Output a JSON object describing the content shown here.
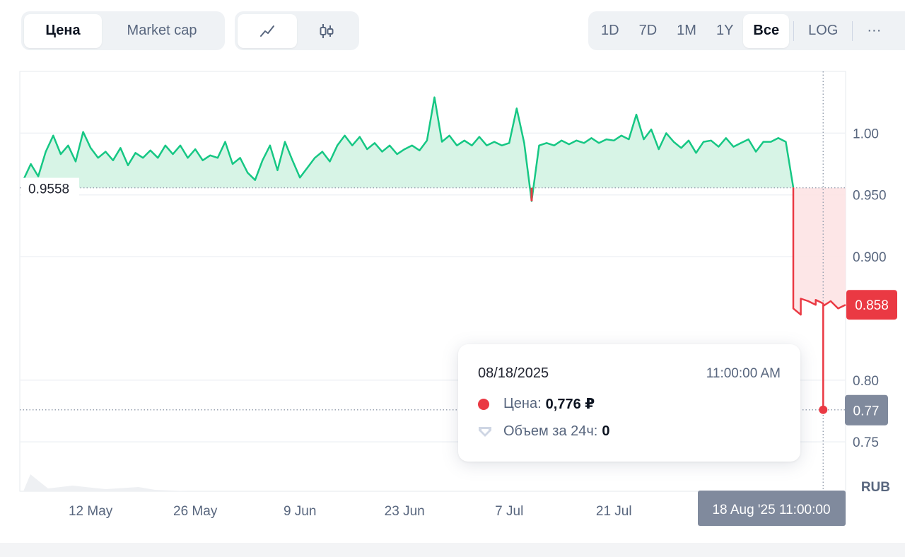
{
  "toolbar": {
    "metric_tabs": [
      {
        "label": "Цена",
        "active": true
      },
      {
        "label": "Market cap",
        "active": false
      }
    ],
    "chart_type_tabs": [
      {
        "icon": "line-chart-icon",
        "active": true
      },
      {
        "icon": "candlestick-icon",
        "active": false
      }
    ],
    "range_tabs": [
      {
        "label": "1D",
        "active": false
      },
      {
        "label": "7D",
        "active": false
      },
      {
        "label": "1M",
        "active": false
      },
      {
        "label": "1Y",
        "active": false
      },
      {
        "label": "Все",
        "active": true
      }
    ],
    "log_label": "LOG",
    "more_label": "···"
  },
  "colors": {
    "up": "#16c784",
    "down": "#ea3943",
    "up_fill": "#d3f3e3",
    "down_fill": "#fde3e4",
    "grid": "#eff2f5",
    "hover_label_bg": "#808a9d"
  },
  "chart_data": {
    "type": "line",
    "currency_label": "RUB",
    "baseline": 0.9558,
    "baseline_label": "0.9558",
    "current_price_label": "0.858",
    "hover_price_label": "0.77",
    "hover_time_label": "18 Aug '25 11:00:00",
    "y_ticks": [
      "1.00",
      "0.950",
      "0.900",
      "0.80",
      "0.75"
    ],
    "y_tick_values": [
      1.0,
      0.95,
      0.9,
      0.8,
      0.75
    ],
    "ylim": [
      0.71,
      1.05
    ],
    "x_ticks": [
      "12 May",
      "26 May",
      "9 Jun",
      "23 Jun",
      "7 Jul",
      "21 Jul"
    ],
    "x_tick_dates": [
      "2025-05-12",
      "2025-05-26",
      "2025-06-09",
      "2025-06-23",
      "2025-07-07",
      "2025-07-21"
    ],
    "xlim": [
      "2025-05-03",
      "2025-08-21"
    ],
    "series": [
      {
        "points": [
          [
            "2025-05-03",
            0.962
          ],
          [
            "2025-05-04",
            0.975
          ],
          [
            "2025-05-05",
            0.965
          ],
          [
            "2025-05-06",
            0.985
          ],
          [
            "2025-05-07",
            0.998
          ],
          [
            "2025-05-08",
            0.983
          ],
          [
            "2025-05-09",
            0.99
          ],
          [
            "2025-05-10",
            0.977
          ],
          [
            "2025-05-11",
            1.001
          ],
          [
            "2025-05-12",
            0.988
          ],
          [
            "2025-05-13",
            0.98
          ],
          [
            "2025-05-14",
            0.985
          ],
          [
            "2025-05-15",
            0.978
          ],
          [
            "2025-05-16",
            0.988
          ],
          [
            "2025-05-17",
            0.974
          ],
          [
            "2025-05-18",
            0.984
          ],
          [
            "2025-05-19",
            0.98
          ],
          [
            "2025-05-20",
            0.986
          ],
          [
            "2025-05-21",
            0.98
          ],
          [
            "2025-05-22",
            0.99
          ],
          [
            "2025-05-23",
            0.983
          ],
          [
            "2025-05-24",
            0.99
          ],
          [
            "2025-05-25",
            0.98
          ],
          [
            "2025-05-26",
            0.987
          ],
          [
            "2025-05-27",
            0.978
          ],
          [
            "2025-05-28",
            0.982
          ],
          [
            "2025-05-29",
            0.98
          ],
          [
            "2025-05-30",
            0.993
          ],
          [
            "2025-05-31",
            0.975
          ],
          [
            "2025-06-01",
            0.98
          ],
          [
            "2025-06-02",
            0.968
          ],
          [
            "2025-06-03",
            0.962
          ],
          [
            "2025-06-04",
            0.978
          ],
          [
            "2025-06-05",
            0.99
          ],
          [
            "2025-06-06",
            0.97
          ],
          [
            "2025-06-07",
            0.993
          ],
          [
            "2025-06-08",
            0.978
          ],
          [
            "2025-06-09",
            0.964
          ],
          [
            "2025-06-10",
            0.972
          ],
          [
            "2025-06-11",
            0.98
          ],
          [
            "2025-06-12",
            0.985
          ],
          [
            "2025-06-13",
            0.977
          ],
          [
            "2025-06-14",
            0.99
          ],
          [
            "2025-06-15",
            0.998
          ],
          [
            "2025-06-16",
            0.99
          ],
          [
            "2025-06-17",
            0.997
          ],
          [
            "2025-06-18",
            0.987
          ],
          [
            "2025-06-19",
            0.992
          ],
          [
            "2025-06-20",
            0.985
          ],
          [
            "2025-06-21",
            0.99
          ],
          [
            "2025-06-22",
            0.983
          ],
          [
            "2025-06-23",
            0.987
          ],
          [
            "2025-06-24",
            0.99
          ],
          [
            "2025-06-25",
            0.986
          ],
          [
            "2025-06-26",
            0.994
          ],
          [
            "2025-06-27",
            1.029
          ],
          [
            "2025-06-28",
            0.993
          ],
          [
            "2025-06-29",
            0.998
          ],
          [
            "2025-06-30",
            0.99
          ],
          [
            "2025-07-01",
            0.994
          ],
          [
            "2025-07-02",
            0.99
          ],
          [
            "2025-07-03",
            0.997
          ],
          [
            "2025-07-04",
            0.99
          ],
          [
            "2025-07-05",
            0.993
          ],
          [
            "2025-07-06",
            0.99
          ],
          [
            "2025-07-07",
            0.992
          ],
          [
            "2025-07-08",
            1.02
          ],
          [
            "2025-07-09",
            0.992
          ],
          [
            "2025-07-10",
            0.945
          ],
          [
            "2025-07-11",
            0.99
          ],
          [
            "2025-07-12",
            0.992
          ],
          [
            "2025-07-13",
            0.99
          ],
          [
            "2025-07-14",
            0.994
          ],
          [
            "2025-07-15",
            0.991
          ],
          [
            "2025-07-16",
            0.994
          ],
          [
            "2025-07-17",
            0.992
          ],
          [
            "2025-07-18",
            0.996
          ],
          [
            "2025-07-19",
            0.992
          ],
          [
            "2025-07-20",
            0.995
          ],
          [
            "2025-07-21",
            0.994
          ],
          [
            "2025-07-22",
            0.998
          ],
          [
            "2025-07-23",
            0.995
          ],
          [
            "2025-07-24",
            1.015
          ],
          [
            "2025-07-25",
            0.995
          ],
          [
            "2025-07-26",
            1.003
          ],
          [
            "2025-07-27",
            0.987
          ],
          [
            "2025-07-28",
            1.0
          ],
          [
            "2025-07-29",
            0.993
          ],
          [
            "2025-07-30",
            0.988
          ],
          [
            "2025-07-31",
            0.994
          ],
          [
            "2025-08-01",
            0.984
          ],
          [
            "2025-08-02",
            0.993
          ],
          [
            "2025-08-03",
            0.994
          ],
          [
            "2025-08-04",
            0.989
          ],
          [
            "2025-08-05",
            0.996
          ],
          [
            "2025-08-06",
            0.989
          ],
          [
            "2025-08-07",
            0.992
          ],
          [
            "2025-08-08",
            0.995
          ],
          [
            "2025-08-09",
            0.985
          ],
          [
            "2025-08-10",
            0.993
          ],
          [
            "2025-08-11",
            0.993
          ],
          [
            "2025-08-12",
            0.996
          ],
          [
            "2025-08-13",
            0.993
          ],
          [
            "2025-08-14",
            0.956
          ],
          [
            "2025-08-14",
            0.858
          ],
          [
            "2025-08-15",
            0.853
          ],
          [
            "2025-08-15",
            0.866
          ],
          [
            "2025-08-16",
            0.864
          ],
          [
            "2025-08-17",
            0.861
          ],
          [
            "2025-08-17",
            0.865
          ],
          [
            "2025-08-18",
            0.862
          ],
          [
            "2025-08-18",
            0.776
          ],
          [
            "2025-08-18",
            0.86
          ],
          [
            "2025-08-19",
            0.864
          ],
          [
            "2025-08-20",
            0.858
          ],
          [
            "2025-08-21",
            0.861
          ]
        ]
      }
    ],
    "hover": {
      "date": "2025-08-18",
      "value": 0.776
    }
  },
  "tooltip": {
    "date": "08/18/2025",
    "time": "11:00:00 AM",
    "price_label": "Цена:",
    "price_value": "0,776 ₽",
    "volume_label": "Объем за 24ч:",
    "volume_value": "0"
  }
}
